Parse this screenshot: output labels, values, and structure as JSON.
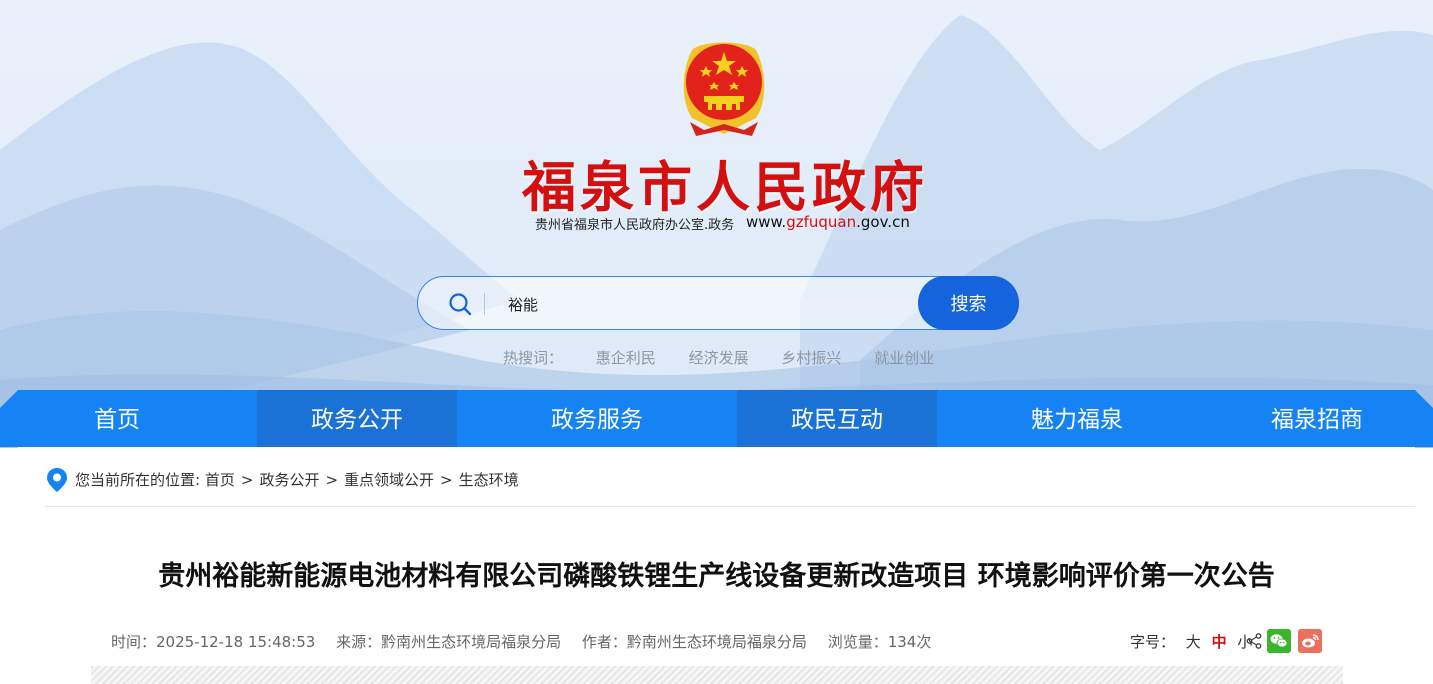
{
  "header": {
    "site_title": "福泉市人民政府",
    "site_subtitle": "贵州省福泉市人民政府办公室.政务",
    "site_url_prefix": "www.",
    "site_url_domain": "gzfuquan",
    "site_url_suffix": ".gov.cn",
    "emblem": "national-emblem"
  },
  "search": {
    "value": "裕能",
    "button_label": "搜索",
    "icon": "search-icon"
  },
  "hotwords": {
    "label": "热搜词：",
    "items": [
      "惠企利民",
      "经济发展",
      "乡村振兴",
      "就业创业"
    ]
  },
  "nav": {
    "items": [
      "首页",
      "政务公开",
      "政务服务",
      "政民互动",
      "魅力福泉",
      "福泉招商"
    ],
    "active_index": 1
  },
  "breadcrumb": {
    "prefix": "您当前所在的位置:",
    "items": [
      "首页",
      "政务公开",
      "重点领域公开",
      "生态环境"
    ],
    "separator": ">"
  },
  "article": {
    "title": "贵州裕能新能源电池材料有限公司磷酸铁锂生产线设备更新改造项目 环境影响评价第一次公告",
    "meta": {
      "time": "时间：2025-12-18 15:48:53",
      "source": "来源：黔南州生态环境局福泉分局",
      "author": "作者：黔南州生态环境局福泉分局",
      "views": "浏览量：134次"
    },
    "font_size": {
      "label": "字号：",
      "large": "大",
      "medium": "中",
      "small": "小"
    }
  },
  "colors": {
    "brand_red": "#d40f0f",
    "nav_blue": "#1583f3",
    "nav_active": "#1a72d6",
    "search_button": "#1664dd",
    "wechat": "#3bb42e",
    "weibo": "#ef6f5f"
  }
}
